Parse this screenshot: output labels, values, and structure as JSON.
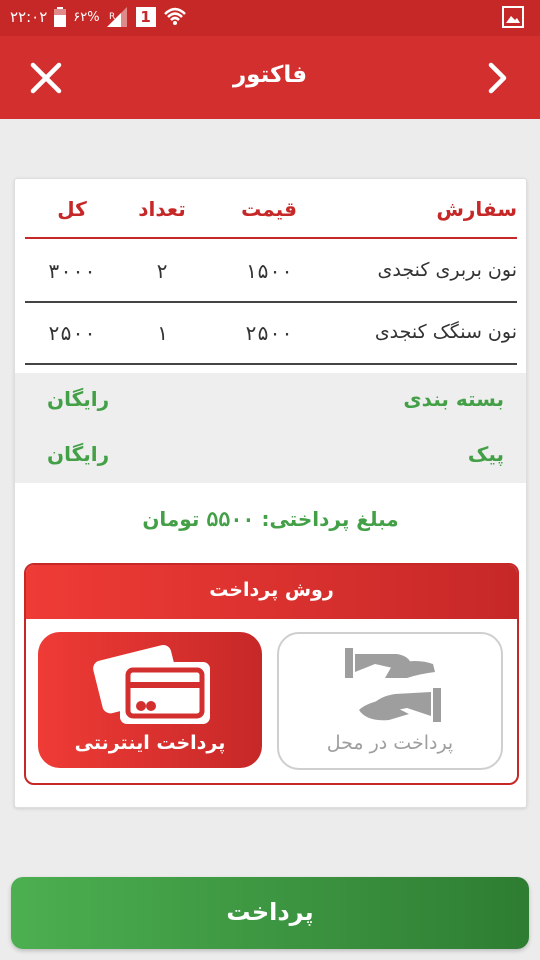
{
  "status_bar": {
    "time": "۲۲:۰۲",
    "battery": "۶۲%",
    "sim_badge": "1"
  },
  "header": {
    "title": "فاکتور",
    "close_icon": "close-icon",
    "next_icon": "chevron-right-icon"
  },
  "order_table": {
    "columns": [
      "سفارش",
      "قیمت",
      "تعداد",
      "کل"
    ],
    "rows": [
      {
        "name": "نون بربری کنجدی",
        "price": "۱۵۰۰",
        "qty": "۲",
        "total": "۳۰۰۰"
      },
      {
        "name": "نون سنگک کنجدی",
        "price": "۲۵۰۰",
        "qty": "۱",
        "total": "۲۵۰۰"
      }
    ]
  },
  "extras": {
    "packaging": {
      "label": "بسته بندی",
      "value": "رایگان"
    },
    "delivery": {
      "label": "پیک",
      "value": "رایگان"
    }
  },
  "amount": {
    "label": "مبلغ پرداختی:",
    "value": "۵۵۰۰",
    "unit": "تومان"
  },
  "payment_method": {
    "title": "روش پرداخت",
    "online": {
      "label": "پرداخت اینترنتی",
      "icon": "credit-card-icon",
      "selected": true
    },
    "cash": {
      "label": "پرداخت در محل",
      "icon": "hand-payment-icon",
      "selected": false
    }
  },
  "pay_button": {
    "label": "پرداخت"
  },
  "colors": {
    "primary_red": "#d32f2f",
    "accent_green": "#43a047",
    "button_green": "#2e7d32"
  }
}
